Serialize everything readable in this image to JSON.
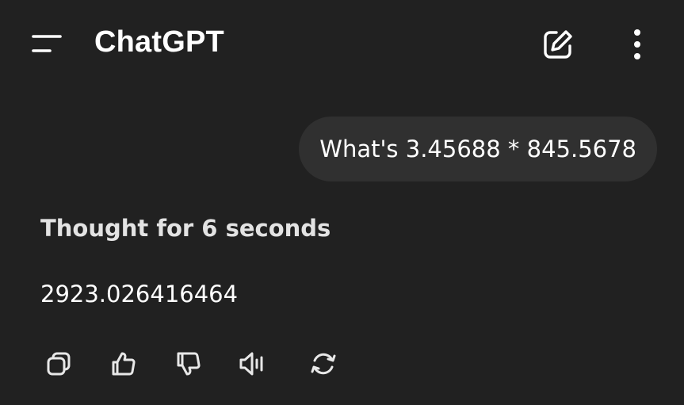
{
  "header": {
    "title": "ChatGPT",
    "icons": {
      "menu": "menu-icon",
      "new_chat": "edit-icon",
      "more": "more-vertical-icon"
    }
  },
  "conversation": {
    "user_message": "What's 3.45688 * 845.5678",
    "assistant": {
      "thought_label": "Thought for 6 seconds",
      "answer": "2923.026416464"
    }
  },
  "message_actions": [
    {
      "name": "copy",
      "icon": "copy-icon"
    },
    {
      "name": "thumbs-up",
      "icon": "thumbs-up-icon"
    },
    {
      "name": "thumbs-down",
      "icon": "thumbs-down-icon"
    },
    {
      "name": "read-aloud",
      "icon": "speaker-icon"
    },
    {
      "name": "regenerate",
      "icon": "refresh-icon"
    }
  ],
  "colors": {
    "background": "#212121",
    "bubble": "#303030",
    "text": "#ffffff",
    "icon": "#e8e8e8"
  }
}
